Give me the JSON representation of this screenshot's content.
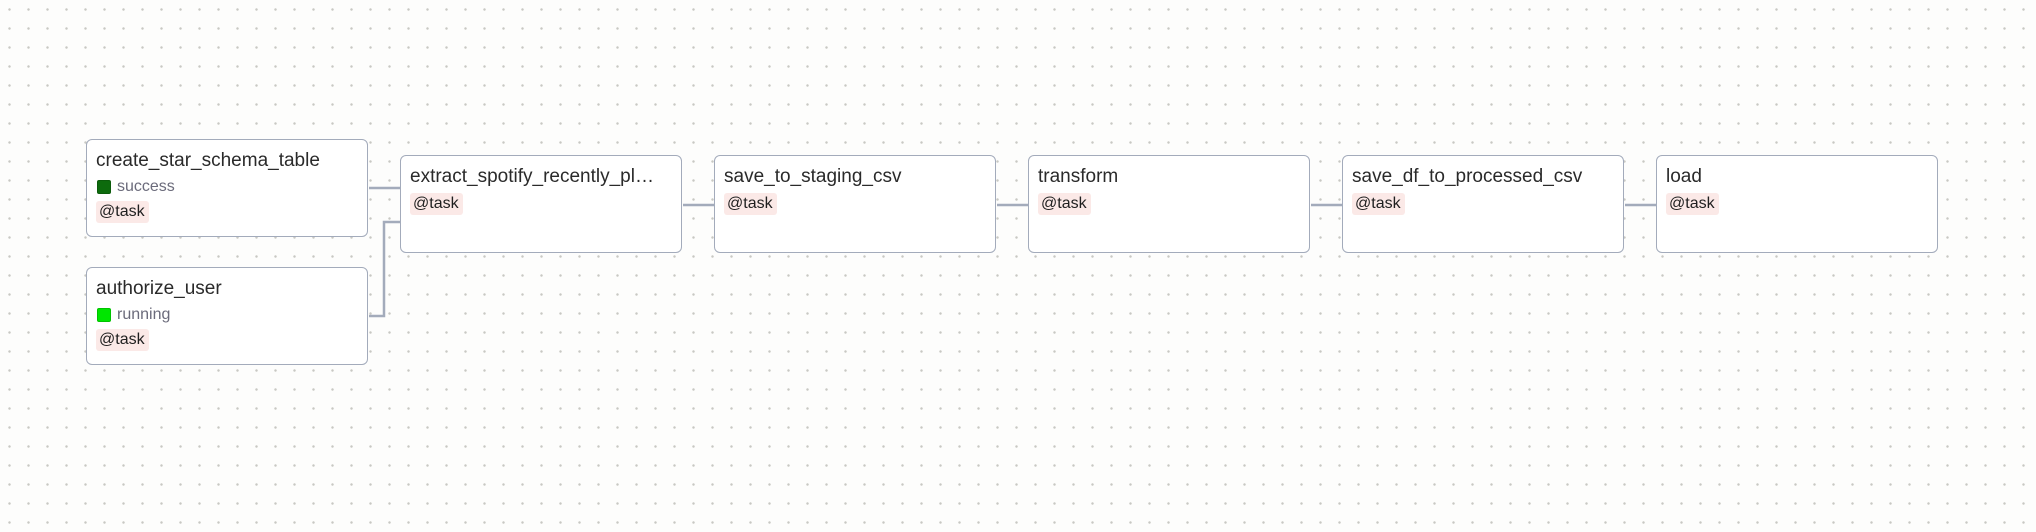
{
  "nodes": [
    {
      "id": "create_star_schema_table",
      "label": "create_star_schema_table",
      "status": "success",
      "status_color": "#0d6b0d",
      "operator": "@task"
    },
    {
      "id": "authorize_user",
      "label": "authorize_user",
      "status": "running",
      "status_color": "#00e600",
      "operator": "@task"
    },
    {
      "id": "extract_spotify_recently_played",
      "label": "extract_spotify_recently_pl…",
      "operator": "@task"
    },
    {
      "id": "save_to_staging_csv",
      "label": "save_to_staging_csv",
      "operator": "@task"
    },
    {
      "id": "transform",
      "label": "transform",
      "operator": "@task"
    },
    {
      "id": "save_df_to_processed_csv",
      "label": "save_df_to_processed_csv",
      "operator": "@task"
    },
    {
      "id": "load",
      "label": "load",
      "operator": "@task"
    }
  ],
  "edges": [
    [
      "create_star_schema_table",
      "extract_spotify_recently_played"
    ],
    [
      "authorize_user",
      "extract_spotify_recently_played"
    ],
    [
      "extract_spotify_recently_played",
      "save_to_staging_csv"
    ],
    [
      "save_to_staging_csv",
      "transform"
    ],
    [
      "transform",
      "save_df_to_processed_csv"
    ],
    [
      "save_df_to_processed_csv",
      "load"
    ]
  ],
  "colors": {
    "edge": "#a3abbb",
    "node_border": "#a3abbb",
    "operator_bg": "#fbe9e7"
  }
}
